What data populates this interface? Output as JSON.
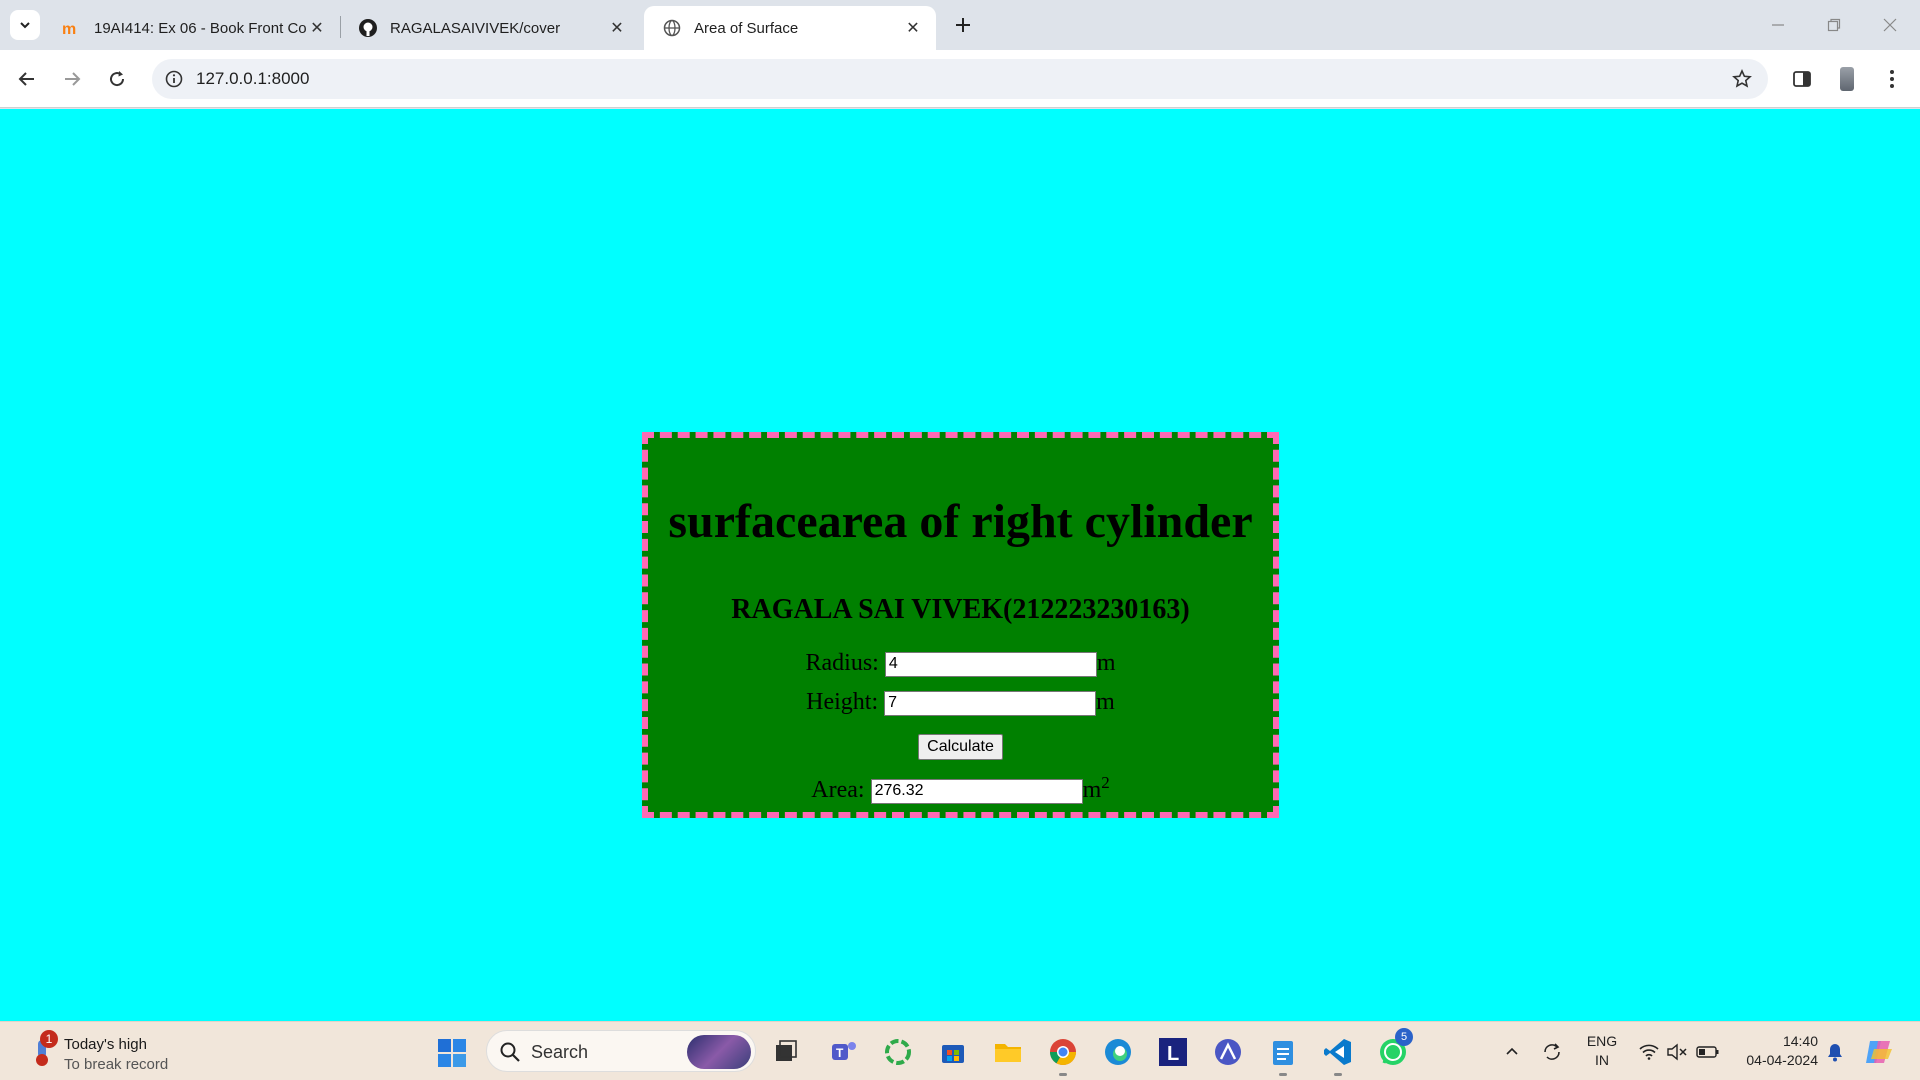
{
  "browser": {
    "tabs": [
      {
        "title": "19AI414: Ex 06 - Book Front Co",
        "favicon": "moodle-icon",
        "active": false
      },
      {
        "title": "RAGALASAIVIVEK/cover",
        "favicon": "github-icon",
        "active": false
      },
      {
        "title": "Area of Surface",
        "favicon": "globe-icon",
        "active": true
      }
    ],
    "url": "127.0.0.1:8000"
  },
  "page": {
    "background": "#00ffff",
    "card_background": "#008000",
    "card_border": "#ff69b4",
    "heading": "surfacearea of right cylinder",
    "subheading": "RAGALA SAI VIVEK(212223230163)",
    "radius": {
      "label": "Radius:",
      "value": "4",
      "unit": "m"
    },
    "height": {
      "label": "Height:",
      "value": "7",
      "unit": "m"
    },
    "calculate_label": "Calculate",
    "area": {
      "label": "Area:",
      "value": "276.32",
      "unit": "m",
      "unit_exponent": "2"
    }
  },
  "taskbar": {
    "weather": {
      "badge": "1",
      "line1": "Today's high",
      "line2": "To break record"
    },
    "search_placeholder": "Search",
    "whatsapp_badge": "5",
    "language": {
      "line1": "ENG",
      "line2": "IN"
    },
    "time": "14:40",
    "date": "04-04-2024"
  }
}
